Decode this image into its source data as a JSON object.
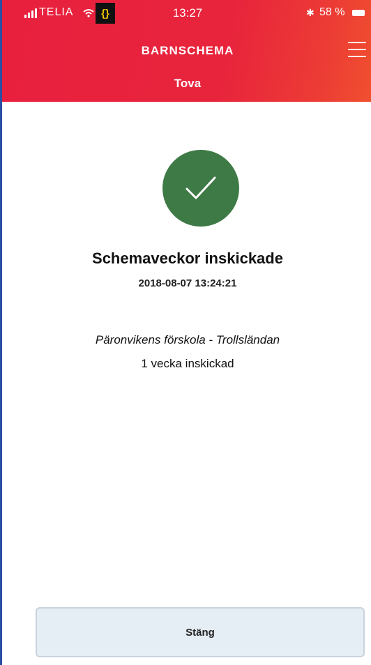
{
  "status_bar": {
    "carrier": "TELIA",
    "vpn_badge": "{}",
    "time": "13:27",
    "battery_percent": "58 %"
  },
  "header": {
    "title": "BARNSCHEMA",
    "child_name": "Tova"
  },
  "confirmation": {
    "title": "Schemaveckor inskickade",
    "timestamp": "2018-08-07 13:24:21",
    "school": "Päronvikens förskola - Trollsländan",
    "weeks_sent": "1 vecka inskickad"
  },
  "actions": {
    "close_label": "Stäng"
  },
  "colors": {
    "header_red": "#e8203e",
    "success_green": "#3e7a45",
    "button_bg": "#e5edf5"
  },
  "icons": {
    "signal": "signal-bars-icon",
    "wifi": "wifi-icon",
    "bluetooth": "bluetooth-icon",
    "battery": "battery-icon",
    "menu": "hamburger-menu-icon",
    "success": "checkmark-icon"
  }
}
